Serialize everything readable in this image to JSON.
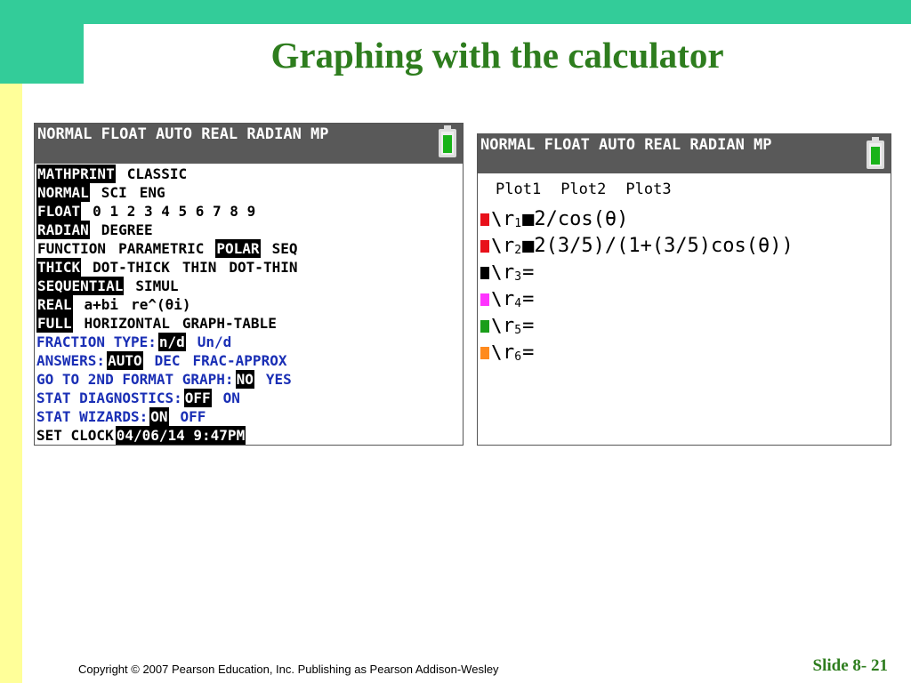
{
  "slide": {
    "title": "Graphing with the calculator",
    "copyright": "Copyright © 2007 Pearson Education, Inc. Publishing as Pearson Addison-Wesley",
    "slide_number": "Slide 8- 21"
  },
  "mode_screen": {
    "status_bar": "NORMAL FLOAT AUTO REAL RADIAN MP",
    "battery_icon": "battery-icon",
    "rows": [
      {
        "color": "#000000",
        "label": "",
        "options": [
          {
            "text": "MATHPRINT",
            "selected": true
          },
          {
            "text": "CLASSIC",
            "selected": false
          }
        ]
      },
      {
        "color": "#000000",
        "label": "",
        "options": [
          {
            "text": "NORMAL",
            "selected": true
          },
          {
            "text": "SCI",
            "selected": false
          },
          {
            "text": "ENG",
            "selected": false
          }
        ]
      },
      {
        "color": "#000000",
        "label": "",
        "options": [
          {
            "text": "FLOAT",
            "selected": true
          },
          {
            "text": "0 1 2 3 4 5 6 7 8 9",
            "selected": false
          }
        ]
      },
      {
        "color": "#000000",
        "label": "",
        "options": [
          {
            "text": "RADIAN",
            "selected": true
          },
          {
            "text": "DEGREE",
            "selected": false
          }
        ]
      },
      {
        "color": "#000000",
        "label": "",
        "options": [
          {
            "text": "FUNCTION",
            "selected": false
          },
          {
            "text": "PARAMETRIC",
            "selected": false
          },
          {
            "text": "POLAR",
            "selected": true
          },
          {
            "text": "SEQ",
            "selected": false
          }
        ]
      },
      {
        "color": "#000000",
        "label": "",
        "options": [
          {
            "text": "THICK",
            "selected": true
          },
          {
            "text": "DOT-THICK",
            "selected": false
          },
          {
            "text": "THIN",
            "selected": false
          },
          {
            "text": "DOT-THIN",
            "selected": false
          }
        ]
      },
      {
        "color": "#000000",
        "label": "",
        "options": [
          {
            "text": "SEQUENTIAL",
            "selected": true
          },
          {
            "text": "SIMUL",
            "selected": false
          }
        ]
      },
      {
        "color": "#000000",
        "label": "",
        "options": [
          {
            "text": "REAL",
            "selected": true
          },
          {
            "text": "a+bi",
            "selected": false
          },
          {
            "text": "re^(θi)",
            "selected": false
          }
        ]
      },
      {
        "color": "#000000",
        "label": "",
        "options": [
          {
            "text": "FULL",
            "selected": true
          },
          {
            "text": "HORIZONTAL",
            "selected": false
          },
          {
            "text": "GRAPH-TABLE",
            "selected": false
          }
        ]
      },
      {
        "color": "#1a2fb5",
        "label": "FRACTION TYPE:",
        "options": [
          {
            "text": "n/d",
            "selected": true
          },
          {
            "text": "Un/d",
            "selected": false
          }
        ]
      },
      {
        "color": "#1a2fb5",
        "label": "ANSWERS:",
        "options": [
          {
            "text": "AUTO",
            "selected": true
          },
          {
            "text": "DEC",
            "selected": false
          },
          {
            "text": "FRAC-APPROX",
            "selected": false
          }
        ]
      },
      {
        "color": "#1a2fb5",
        "label": "GO TO 2ND FORMAT GRAPH:",
        "options": [
          {
            "text": "NO",
            "selected": true
          },
          {
            "text": "YES",
            "selected": false
          }
        ]
      },
      {
        "color": "#1a2fb5",
        "label": "STAT DIAGNOSTICS:",
        "options": [
          {
            "text": "OFF",
            "selected": true
          },
          {
            "text": "ON",
            "selected": false
          }
        ]
      },
      {
        "color": "#1a2fb5",
        "label": "STAT WIZARDS:",
        "options": [
          {
            "text": "ON",
            "selected": true
          },
          {
            "text": "OFF",
            "selected": false
          }
        ]
      },
      {
        "color": "#000000",
        "label": "SET CLOCK",
        "options": [
          {
            "text": "04/06/14 9:47PM",
            "selected": true
          }
        ]
      }
    ]
  },
  "y_editor_screen": {
    "status_bar": "NORMAL FLOAT AUTO REAL RADIAN MP",
    "battery_icon": "battery-icon",
    "plots": [
      "Plot1",
      "Plot2",
      "Plot3"
    ],
    "equations": [
      {
        "color": "#e8101a",
        "name": "r",
        "sub": "1",
        "sign": "■",
        "expr": "2/cos(θ)"
      },
      {
        "color": "#e8101a",
        "name": "r",
        "sub": "2",
        "sign": "■",
        "expr": "2(3/5)/(1+(3/5)cos(θ))"
      },
      {
        "color": "#000000",
        "name": "r",
        "sub": "3",
        "sign": "=",
        "expr": ""
      },
      {
        "color": "#ff33ff",
        "name": "r",
        "sub": "4",
        "sign": "=",
        "expr": ""
      },
      {
        "color": "#1a9e1a",
        "name": "r",
        "sub": "5",
        "sign": "=",
        "expr": ""
      },
      {
        "color": "#ff8a1e",
        "name": "r",
        "sub": "6",
        "sign": "=",
        "expr": ""
      }
    ]
  }
}
